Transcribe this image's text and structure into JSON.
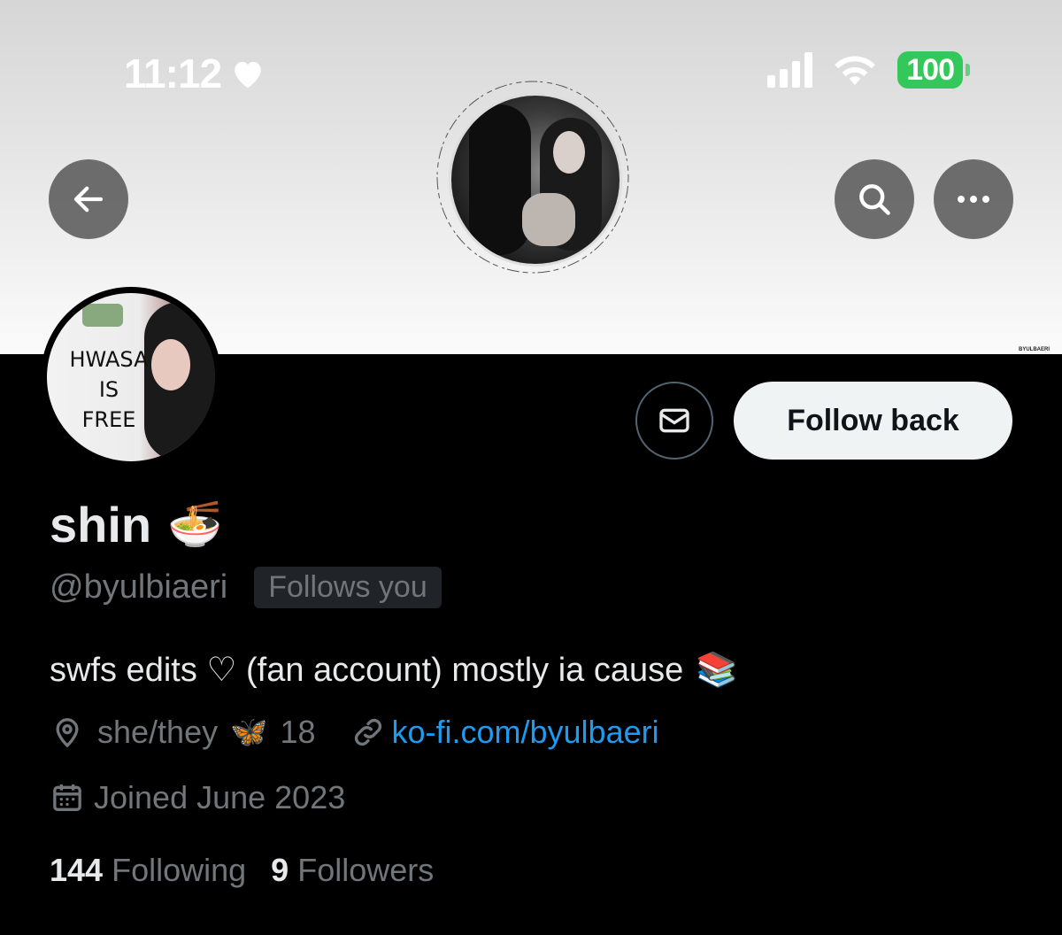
{
  "status_bar": {
    "time": "11:12",
    "battery": "100"
  },
  "banner": {
    "credit": "BYULBAERI"
  },
  "profile": {
    "avatar_sign": "HWASA\nIS\nFREE",
    "name": "shin",
    "name_emoji": "🍜",
    "handle": "@byulbiaeri",
    "follows_you": "Follows you",
    "bio": "swfs edits ♡ (fan account) mostly ia cause",
    "bio_emoji": "📚",
    "location": "she/they",
    "location_emoji": "🦋",
    "age": "18",
    "link": "ko-fi.com/byulbaeri",
    "joined": "Joined June 2023",
    "following_count": "144",
    "following_label": "Following",
    "followers_count": "9",
    "followers_label": "Followers"
  },
  "actions": {
    "follow_back": "Follow back"
  },
  "colors": {
    "accent": "#1d9bf0",
    "battery": "#34c759",
    "muted": "#71767b"
  }
}
